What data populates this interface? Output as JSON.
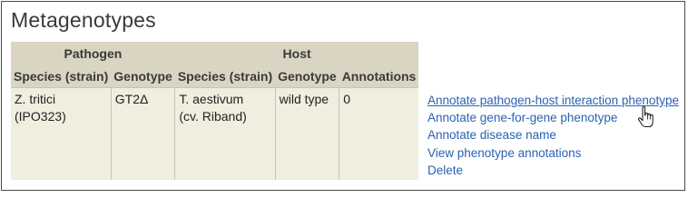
{
  "section": {
    "title": "Metagenotypes"
  },
  "table": {
    "group_headers": {
      "pathogen": "Pathogen",
      "host": "Host"
    },
    "columns": [
      "Species (strain)",
      "Genotype",
      "Species (strain)",
      "Genotype",
      "Annotations"
    ],
    "rows": [
      {
        "pathogen_species": "Z. tritici",
        "pathogen_strain": "(IPO323)",
        "pathogen_genotype": "GT2Δ",
        "host_species": "T. aestivum",
        "host_strain": "(cv. Riband)",
        "host_genotype": "wild type",
        "annotations": "0"
      }
    ]
  },
  "actions": [
    "Annotate pathogen-host interaction phenotype",
    "Annotate gene-for-gene phenotype",
    "Annotate disease name",
    "View phenotype annotations",
    "Delete"
  ],
  "colors": {
    "header_bg": "#d9d5c2",
    "cell_bg": "#efeedf",
    "link": "#2b62b3"
  },
  "cursor": {
    "icon": "hand-pointer-icon"
  }
}
